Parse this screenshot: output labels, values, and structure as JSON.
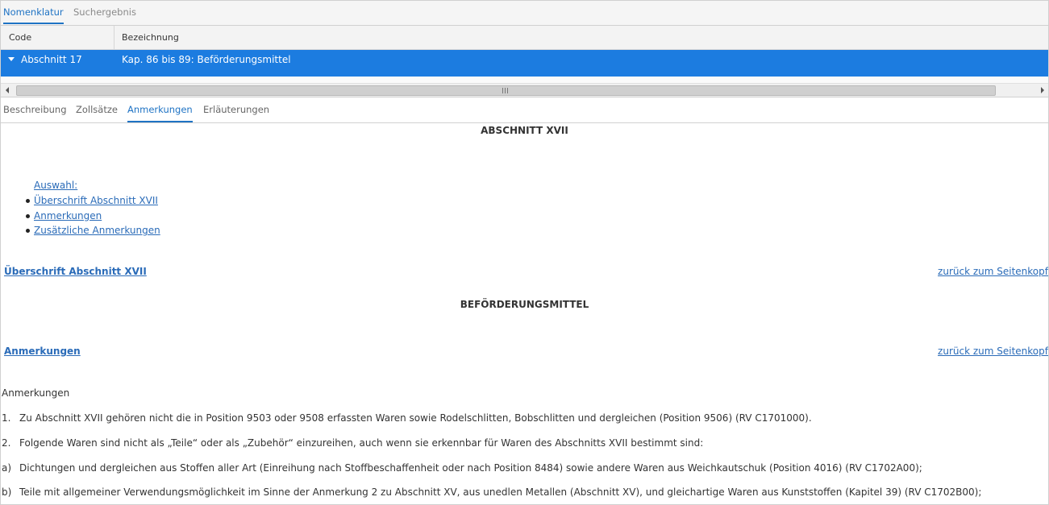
{
  "tabs": {
    "nomenklatur": "Nomenklatur",
    "suchergebnis": "Suchergebnis"
  },
  "grid": {
    "col_code": "Code",
    "col_bezeichnung": "Bezeichnung",
    "row": {
      "code": "Abschnitt 17",
      "bezeichnung": "Kap. 86 bis 89: Beförderungsmittel"
    }
  },
  "detail_tabs": {
    "beschreibung": "Beschreibung",
    "zollsaetze": "Zollsätze",
    "anmerkungen": "Anmerkungen",
    "erlaeuterungen": "Erläuterungen"
  },
  "content": {
    "heading": "ABSCHNITT XVII",
    "toc_label": "Auswahl:",
    "toc": [
      "Überschrift Abschnitt XVII",
      "Anmerkungen",
      "Zusätzliche Anmerkungen"
    ],
    "section1_link": "Überschrift Abschnitt XVII",
    "back_link": "zurück zum Seitenkopf",
    "section1_title": "BEFÖRDERUNGSMITTEL",
    "section2_link": "Anmerkungen",
    "notes_title": "Anmerkungen",
    "notes": [
      {
        "num": "1.",
        "text": "Zu Abschnitt XVII gehören nicht die in Position 9503 oder 9508 erfassten Waren sowie Rodelschlitten, Bobschlitten und dergleichen (Position 9506) (RV C1701000)."
      },
      {
        "num": "2.",
        "text": "Folgende Waren sind nicht als „Teile“ oder als „Zubehör“ einzureihen, auch wenn sie erkennbar für Waren des Abschnitts XVII bestimmt sind:"
      },
      {
        "num": "a)",
        "text": "Dichtungen und dergleichen aus Stoffen aller Art (Einreihung nach Stoffbeschaffenheit oder nach Position 8484) sowie andere Waren aus Weichkautschuk (Position 4016) (RV C1702A00);"
      },
      {
        "num": "b)",
        "text": "Teile mit allgemeiner Verwendungsmöglichkeit im Sinne der Anmerkung 2 zu Abschnitt XV, aus unedlen Metallen (Abschnitt XV), und gleichartige Waren aus Kunststoffen (Kapitel 39) (RV C1702B00);"
      }
    ]
  },
  "colors": {
    "accent": "#1f73c4",
    "selected_row": "#1c7ce0",
    "link": "#2a6bb8"
  }
}
